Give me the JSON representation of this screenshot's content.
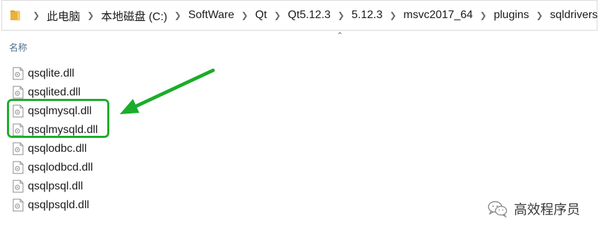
{
  "address_bar": {
    "crumbs": [
      {
        "label": "此电脑"
      },
      {
        "label": "本地磁盘 (C:)"
      },
      {
        "label": "SoftWare"
      },
      {
        "label": "Qt"
      },
      {
        "label": "Qt5.12.3"
      },
      {
        "label": "5.12.3"
      },
      {
        "label": "msvc2017_64"
      },
      {
        "label": "plugins"
      },
      {
        "label": "sqldrivers"
      }
    ]
  },
  "column_header": {
    "name_label": "名称"
  },
  "files": [
    {
      "name": "qsqlite.dll"
    },
    {
      "name": "qsqlited.dll"
    },
    {
      "name": "qsqlmysql.dll"
    },
    {
      "name": "qsqlmysqld.dll"
    },
    {
      "name": "qsqlodbc.dll"
    },
    {
      "name": "qsqlodbcd.dll"
    },
    {
      "name": "qsqlpsql.dll"
    },
    {
      "name": "qsqlpsqld.dll"
    }
  ],
  "annotation": {
    "color": "#1aad2a",
    "highlighted_files": [
      "qsqlmysql.dll",
      "qsqlmysqld.dll"
    ]
  },
  "watermark": {
    "text": "高效程序员"
  },
  "icons": {
    "folder": "folder-icon",
    "separator": "chevron-right-icon",
    "file": "dll-file-icon",
    "collapse": "chevron-up-icon"
  }
}
